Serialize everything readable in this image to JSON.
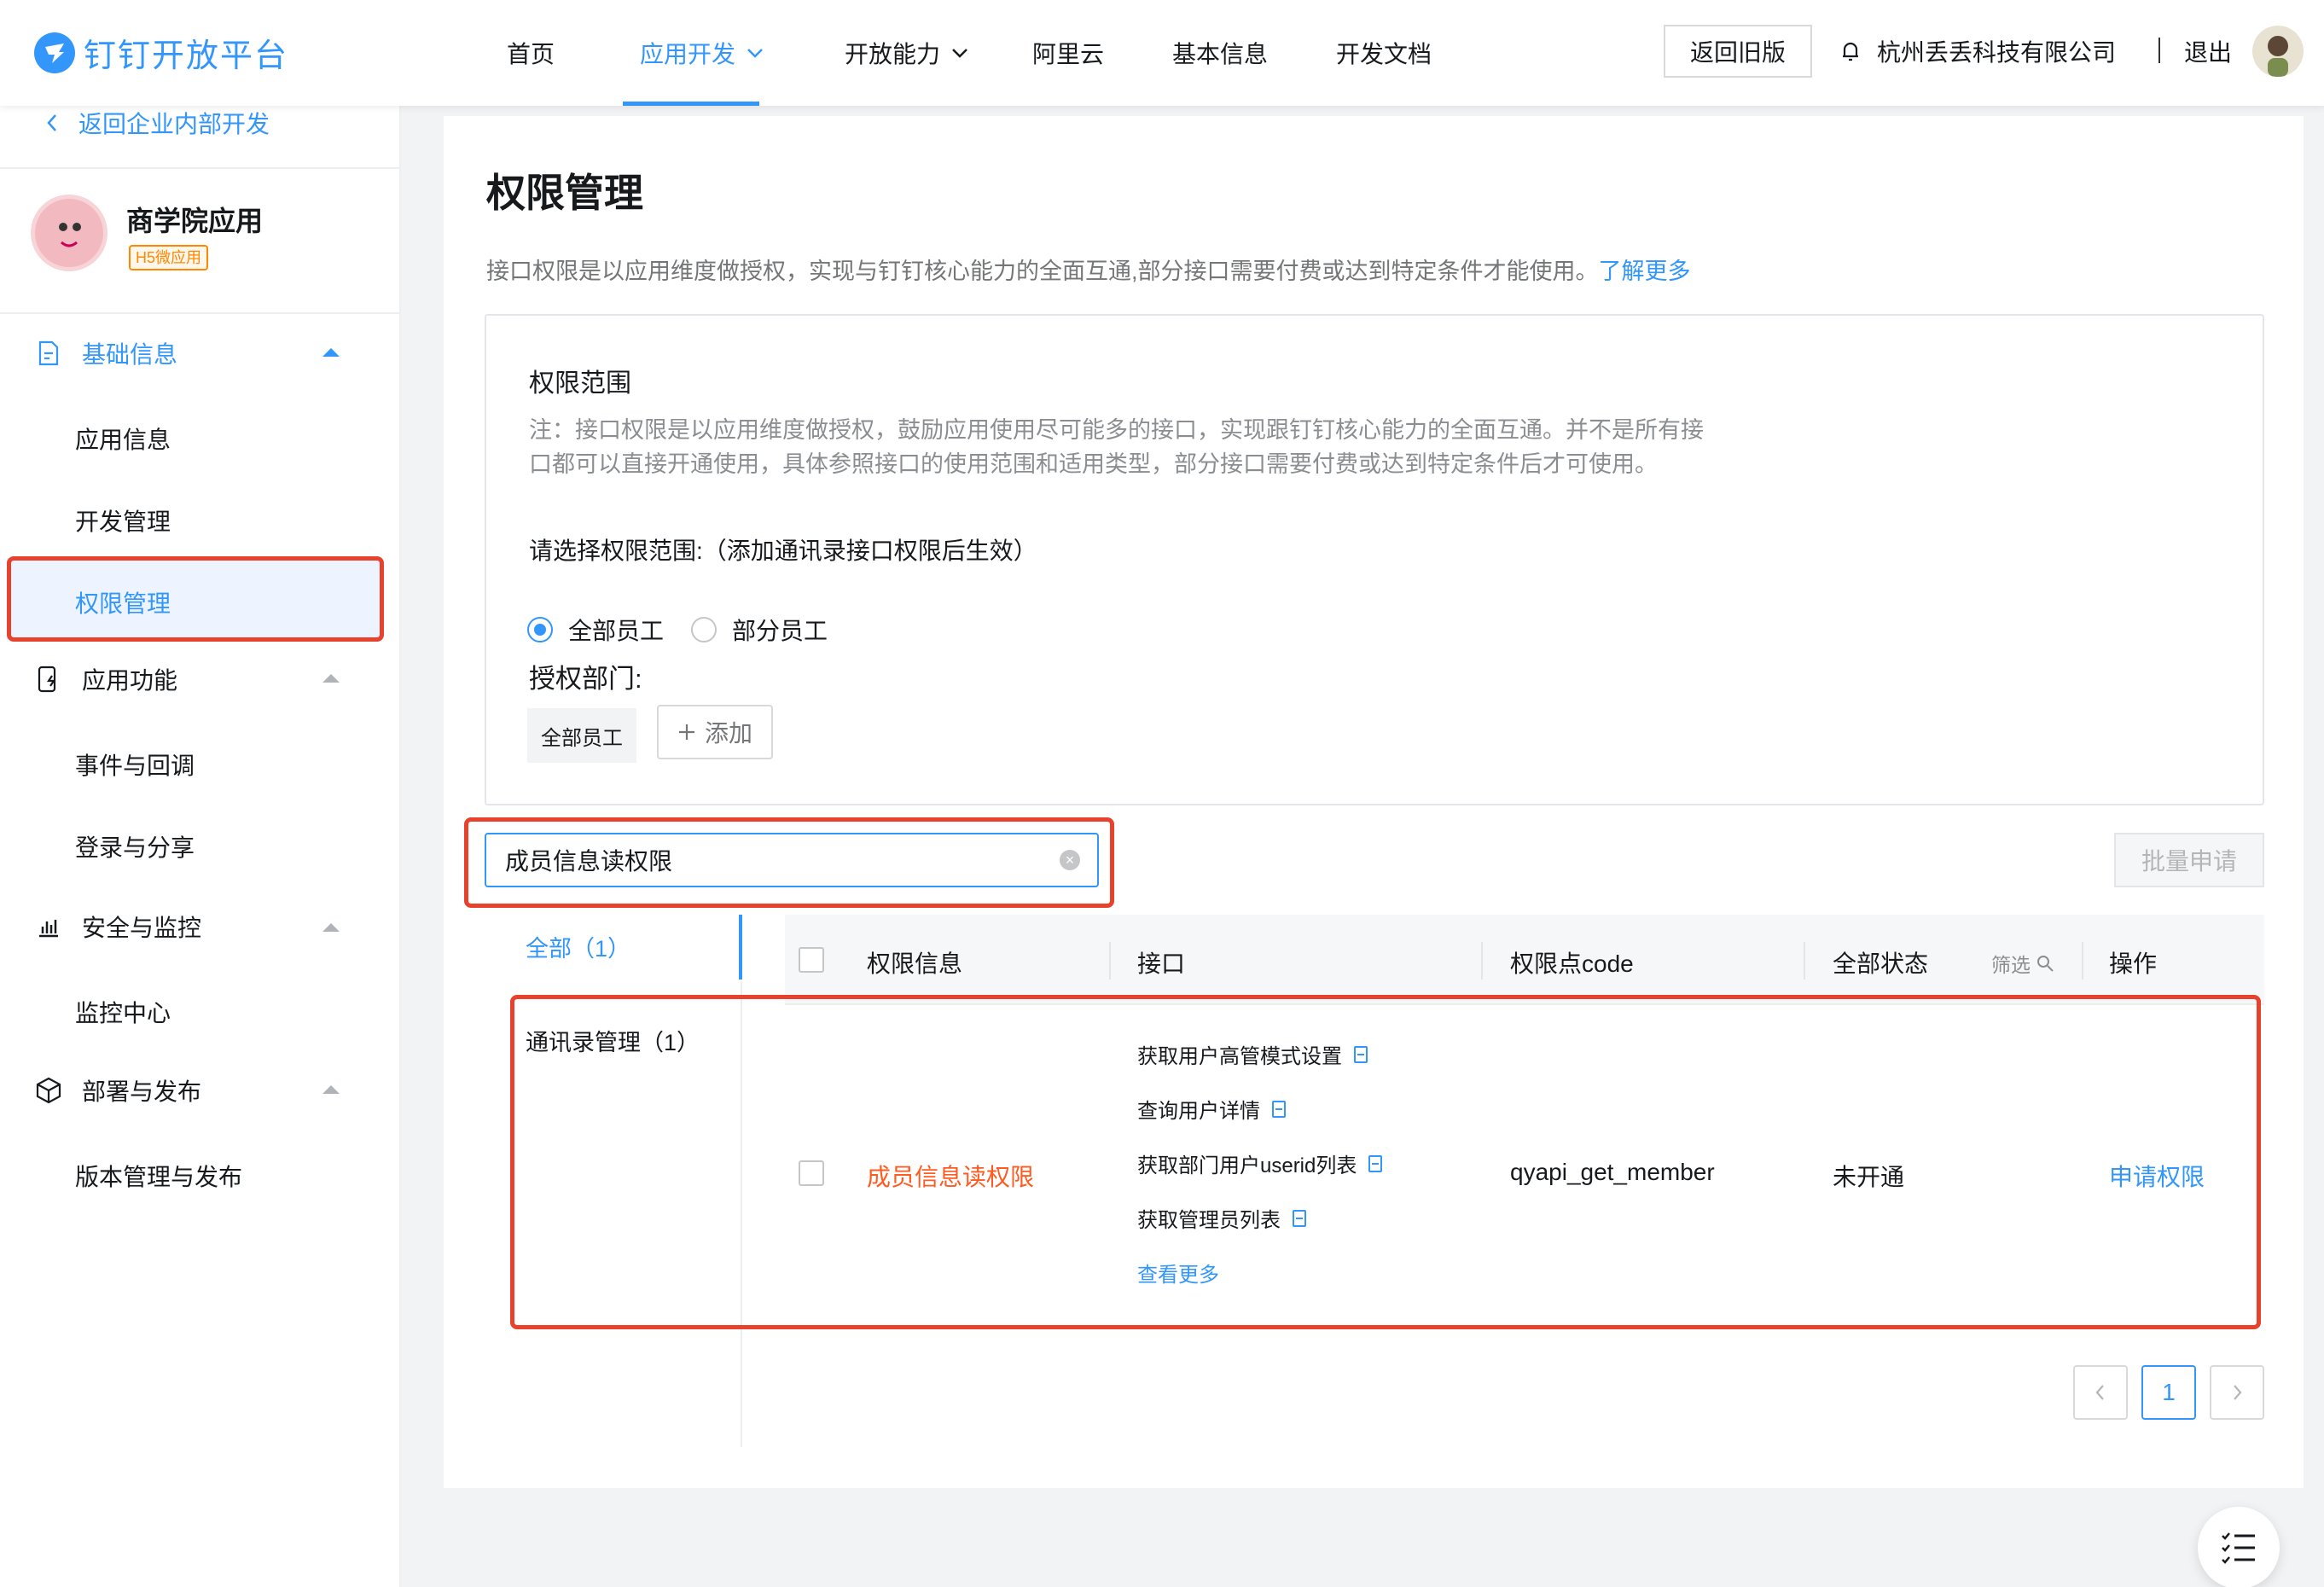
{
  "header": {
    "logo_text": "钉钉开放平台",
    "nav": [
      "首页",
      "应用开发",
      "开放能力",
      "阿里云",
      "基本信息",
      "开发文档"
    ],
    "old_version_button": "返回旧版",
    "company": "杭州丢丢科技有限公司",
    "logout": "退出"
  },
  "sidebar": {
    "back_link": "返回企业内部开发",
    "app": {
      "name": "商学院应用",
      "tag": "H5微应用"
    },
    "groups": [
      {
        "label": "基础信息",
        "items": [
          "应用信息",
          "开发管理",
          "权限管理"
        ]
      },
      {
        "label": "应用功能",
        "items": [
          "事件与回调",
          "登录与分享"
        ]
      },
      {
        "label": "安全与监控",
        "items": [
          "监控中心"
        ]
      },
      {
        "label": "部署与发布",
        "items": [
          "版本管理与发布"
        ]
      }
    ]
  },
  "main": {
    "title": "权限管理",
    "desc": "接口权限是以应用维度做授权，实现与钉钉核心能力的全面互通,部分接口需要付费或达到特定条件才能使用。",
    "learn_more": "了解更多",
    "scope": {
      "title": "权限范围",
      "note": "注：接口权限是以应用维度做授权，鼓励应用使用尽可能多的接口，实现跟钉钉核心能力的全面互通。并不是所有接口都可以直接开通使用，具体参照接口的使用范围和适用类型，部分接口需要付费或达到特定条件后才可使用。",
      "ask": "请选择权限范围:（添加通讯录接口权限后生效）",
      "radio_all": "全部员工",
      "radio_part": "部分员工",
      "dept_label": "授权部门:",
      "dept_tag": "全部员工",
      "add_button": "添加"
    },
    "search": {
      "value": "成员信息读权限"
    },
    "batch_button": "批量申请",
    "categories": [
      {
        "label": "全部（1）"
      },
      {
        "label": "通讯录管理（1）"
      }
    ],
    "table": {
      "headers": [
        "权限信息",
        "接口",
        "权限点code",
        "全部状态",
        "操作"
      ],
      "filter_label": "筛选",
      "rows": [
        {
          "name": "成员信息读权限",
          "apis": [
            "获取用户高管模式设置",
            "查询用户详情",
            "获取部门用户userid列表",
            "获取管理员列表"
          ],
          "more": "查看更多",
          "code": "qyapi_get_member",
          "status": "未开通",
          "action": "申请权限"
        }
      ]
    },
    "pagination": {
      "current": "1"
    }
  },
  "colors": {
    "accent": "#3296fa",
    "highlight": "#e8412c",
    "perm_name": "#ff5a1f",
    "tag": "#ff8800"
  }
}
